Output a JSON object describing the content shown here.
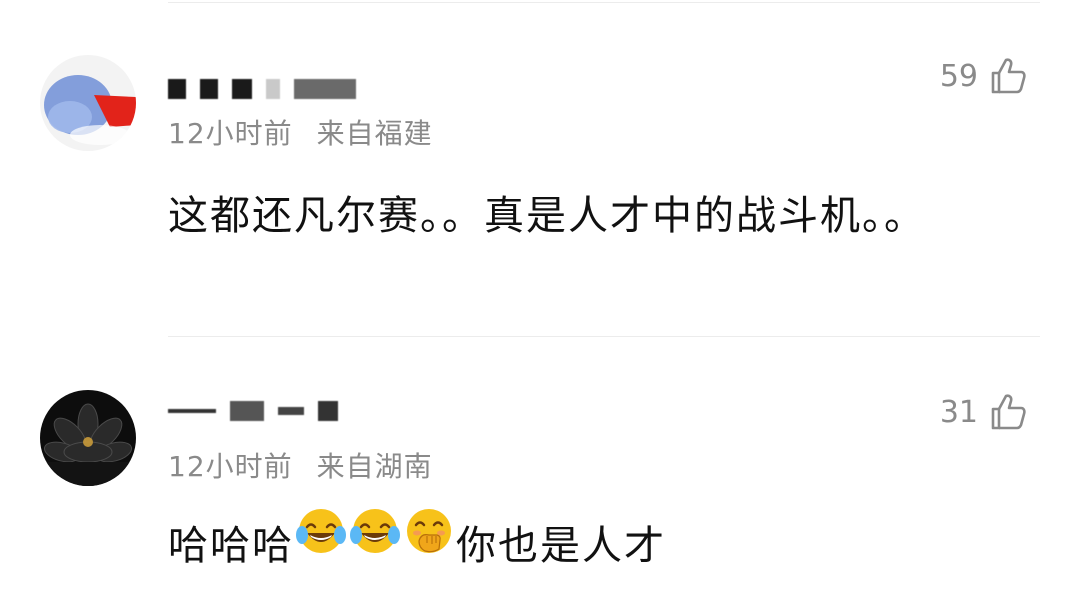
{
  "comments": [
    {
      "author": "",
      "time": "12小时前",
      "location": "来自福建",
      "likes": "59",
      "text": "这都还凡尔赛。。真是人才中的战斗机。。"
    },
    {
      "author": "",
      "time": "12小时前",
      "location": "来自湖南",
      "likes": "31",
      "text_before": "哈哈哈",
      "emojis": [
        "laughing-tears-emoji",
        "laughing-tears-emoji",
        "hand-over-mouth-emoji"
      ],
      "text_after": "你也是人才"
    }
  ],
  "icons": {
    "like": "thumbs-up-outline-icon"
  },
  "colors": {
    "meta_text": "#8a8a8a",
    "body_text": "#111111",
    "divider": "#ececec"
  }
}
